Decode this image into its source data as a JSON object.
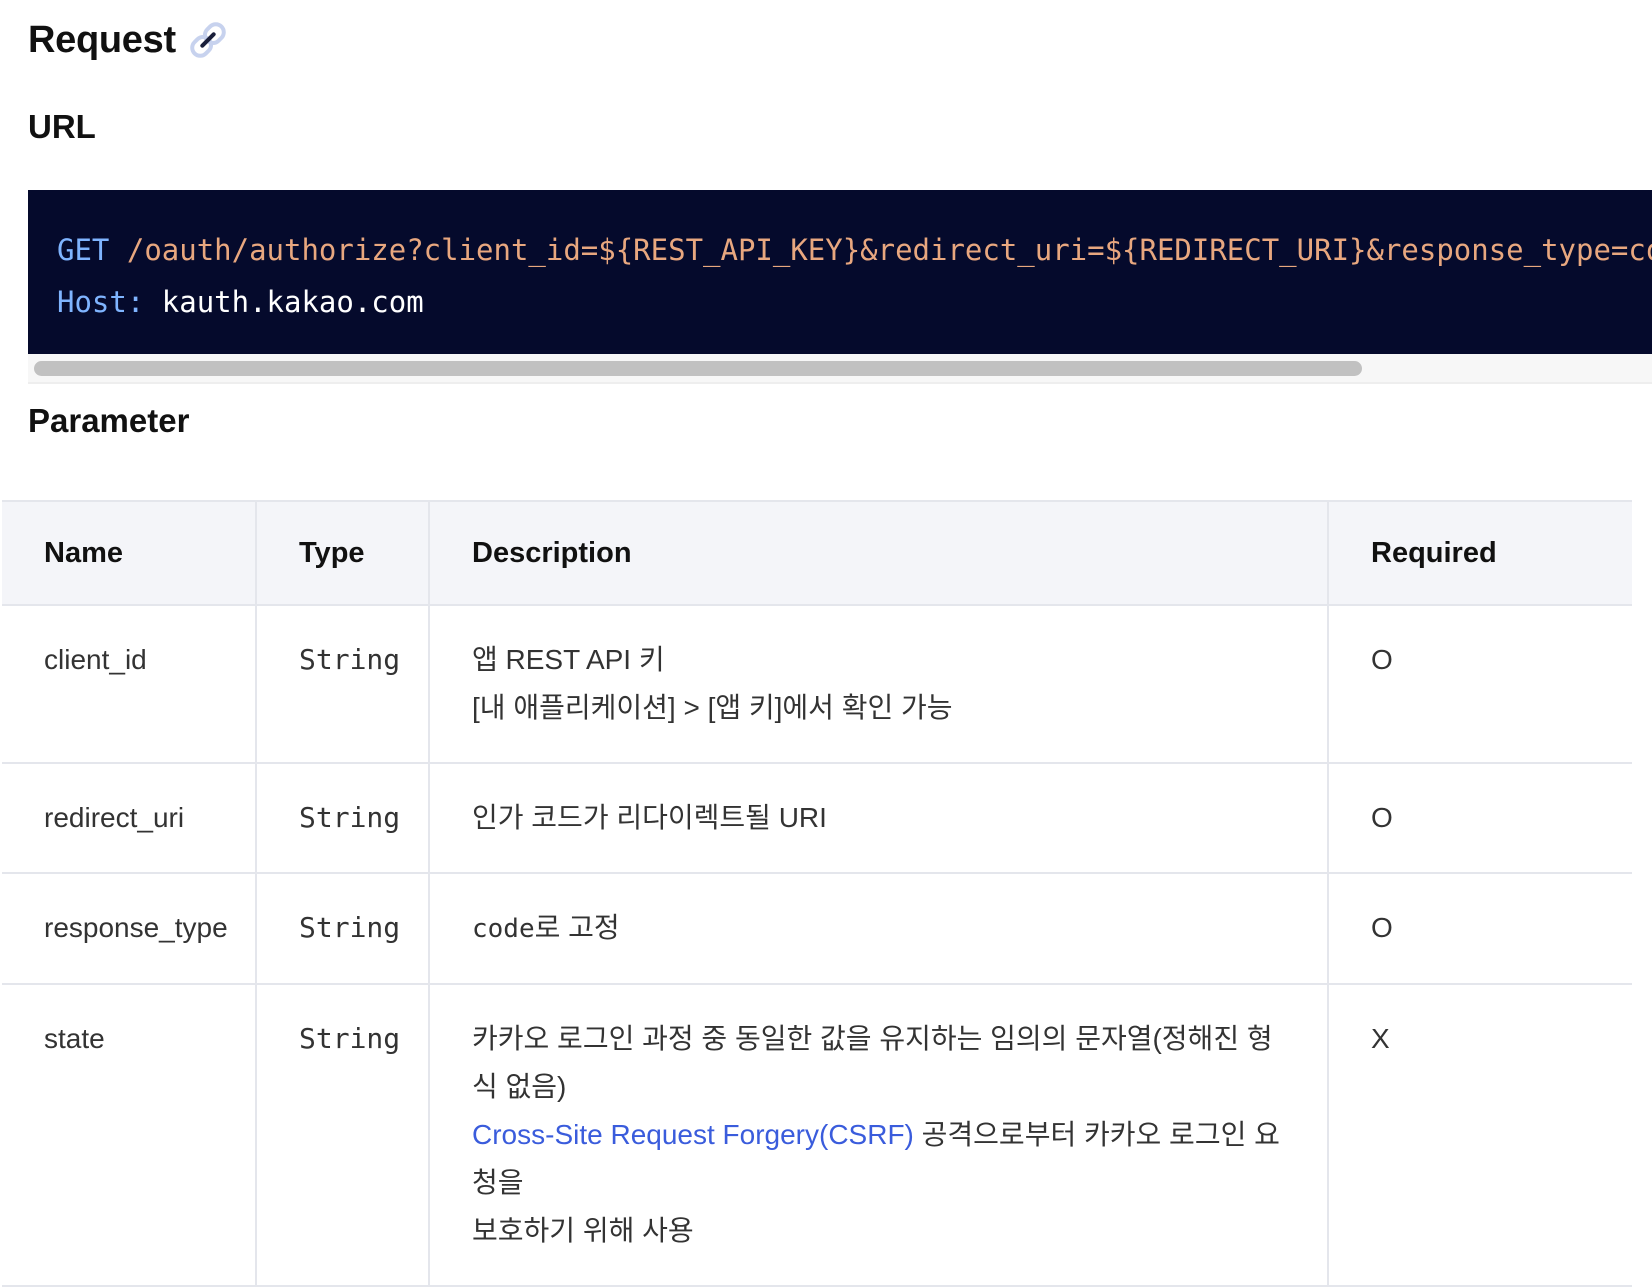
{
  "request": {
    "title": "Request",
    "url_heading": "URL",
    "code": {
      "line1_method": "GET",
      "line1_path": "/oauth/authorize?client_id=${REST_API_KEY}&redirect_uri=${REDIRECT_URI}&response_type=code",
      "line2_key": "Host:",
      "line2_value": "kauth.kakao.com"
    },
    "parameter_heading": "Parameter",
    "table": {
      "headers": {
        "name": "Name",
        "type": "Type",
        "description": "Description",
        "required": "Required"
      },
      "rows": [
        {
          "name": "client_id",
          "type": "String",
          "desc1": "앱 REST API 키",
          "desc2": "[내 애플리케이션] > [앱 키]에서 확인 가능",
          "required": "O"
        },
        {
          "name": "redirect_uri",
          "type": "String",
          "desc1": "인가 코드가 리다이렉트될 URI",
          "required": "O"
        },
        {
          "name": "response_type",
          "type": "String",
          "desc_code": "code",
          "desc_text": "로 고정",
          "required": "O"
        },
        {
          "name": "state",
          "type": "String",
          "desc1": "카카오 로그인 과정 중 동일한 값을 유지하는 임의의 문자열(정해진 형식 없음)",
          "desc_link": "Cross-Site Request Forgery(CSRF)",
          "desc_link_suffix": " 공격으로부터 카카오 로그인 요청을",
          "desc3": "보호하기 위해 사용",
          "required": "X"
        }
      ]
    }
  }
}
